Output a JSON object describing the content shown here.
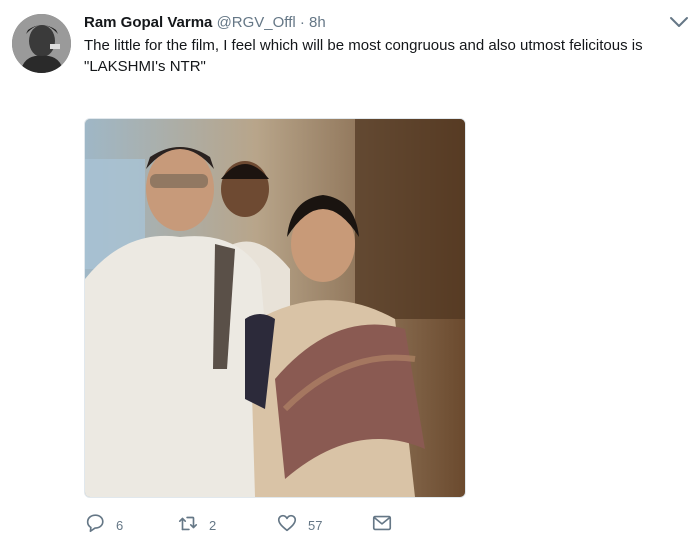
{
  "tweet": {
    "author_name": "Ram Gopal Varma",
    "handle": "@RGV_Offl",
    "separator": "·",
    "time": "8h",
    "text_line1": "The little for the film, I feel which will be most congruous and also utmost felicitous is",
    "text_line2": "\"LAKSHMI's NTR\""
  },
  "actions": {
    "reply_count": "6",
    "retweet_count": "2",
    "like_count": "57"
  },
  "icons": {
    "reply": "reply-icon",
    "retweet": "retweet-icon",
    "like": "heart-icon",
    "dm": "envelope-icon",
    "menu": "chevron-down-icon"
  },
  "colors": {
    "text": "#14171a",
    "muted": "#657786",
    "border": "#e1e8ed"
  }
}
